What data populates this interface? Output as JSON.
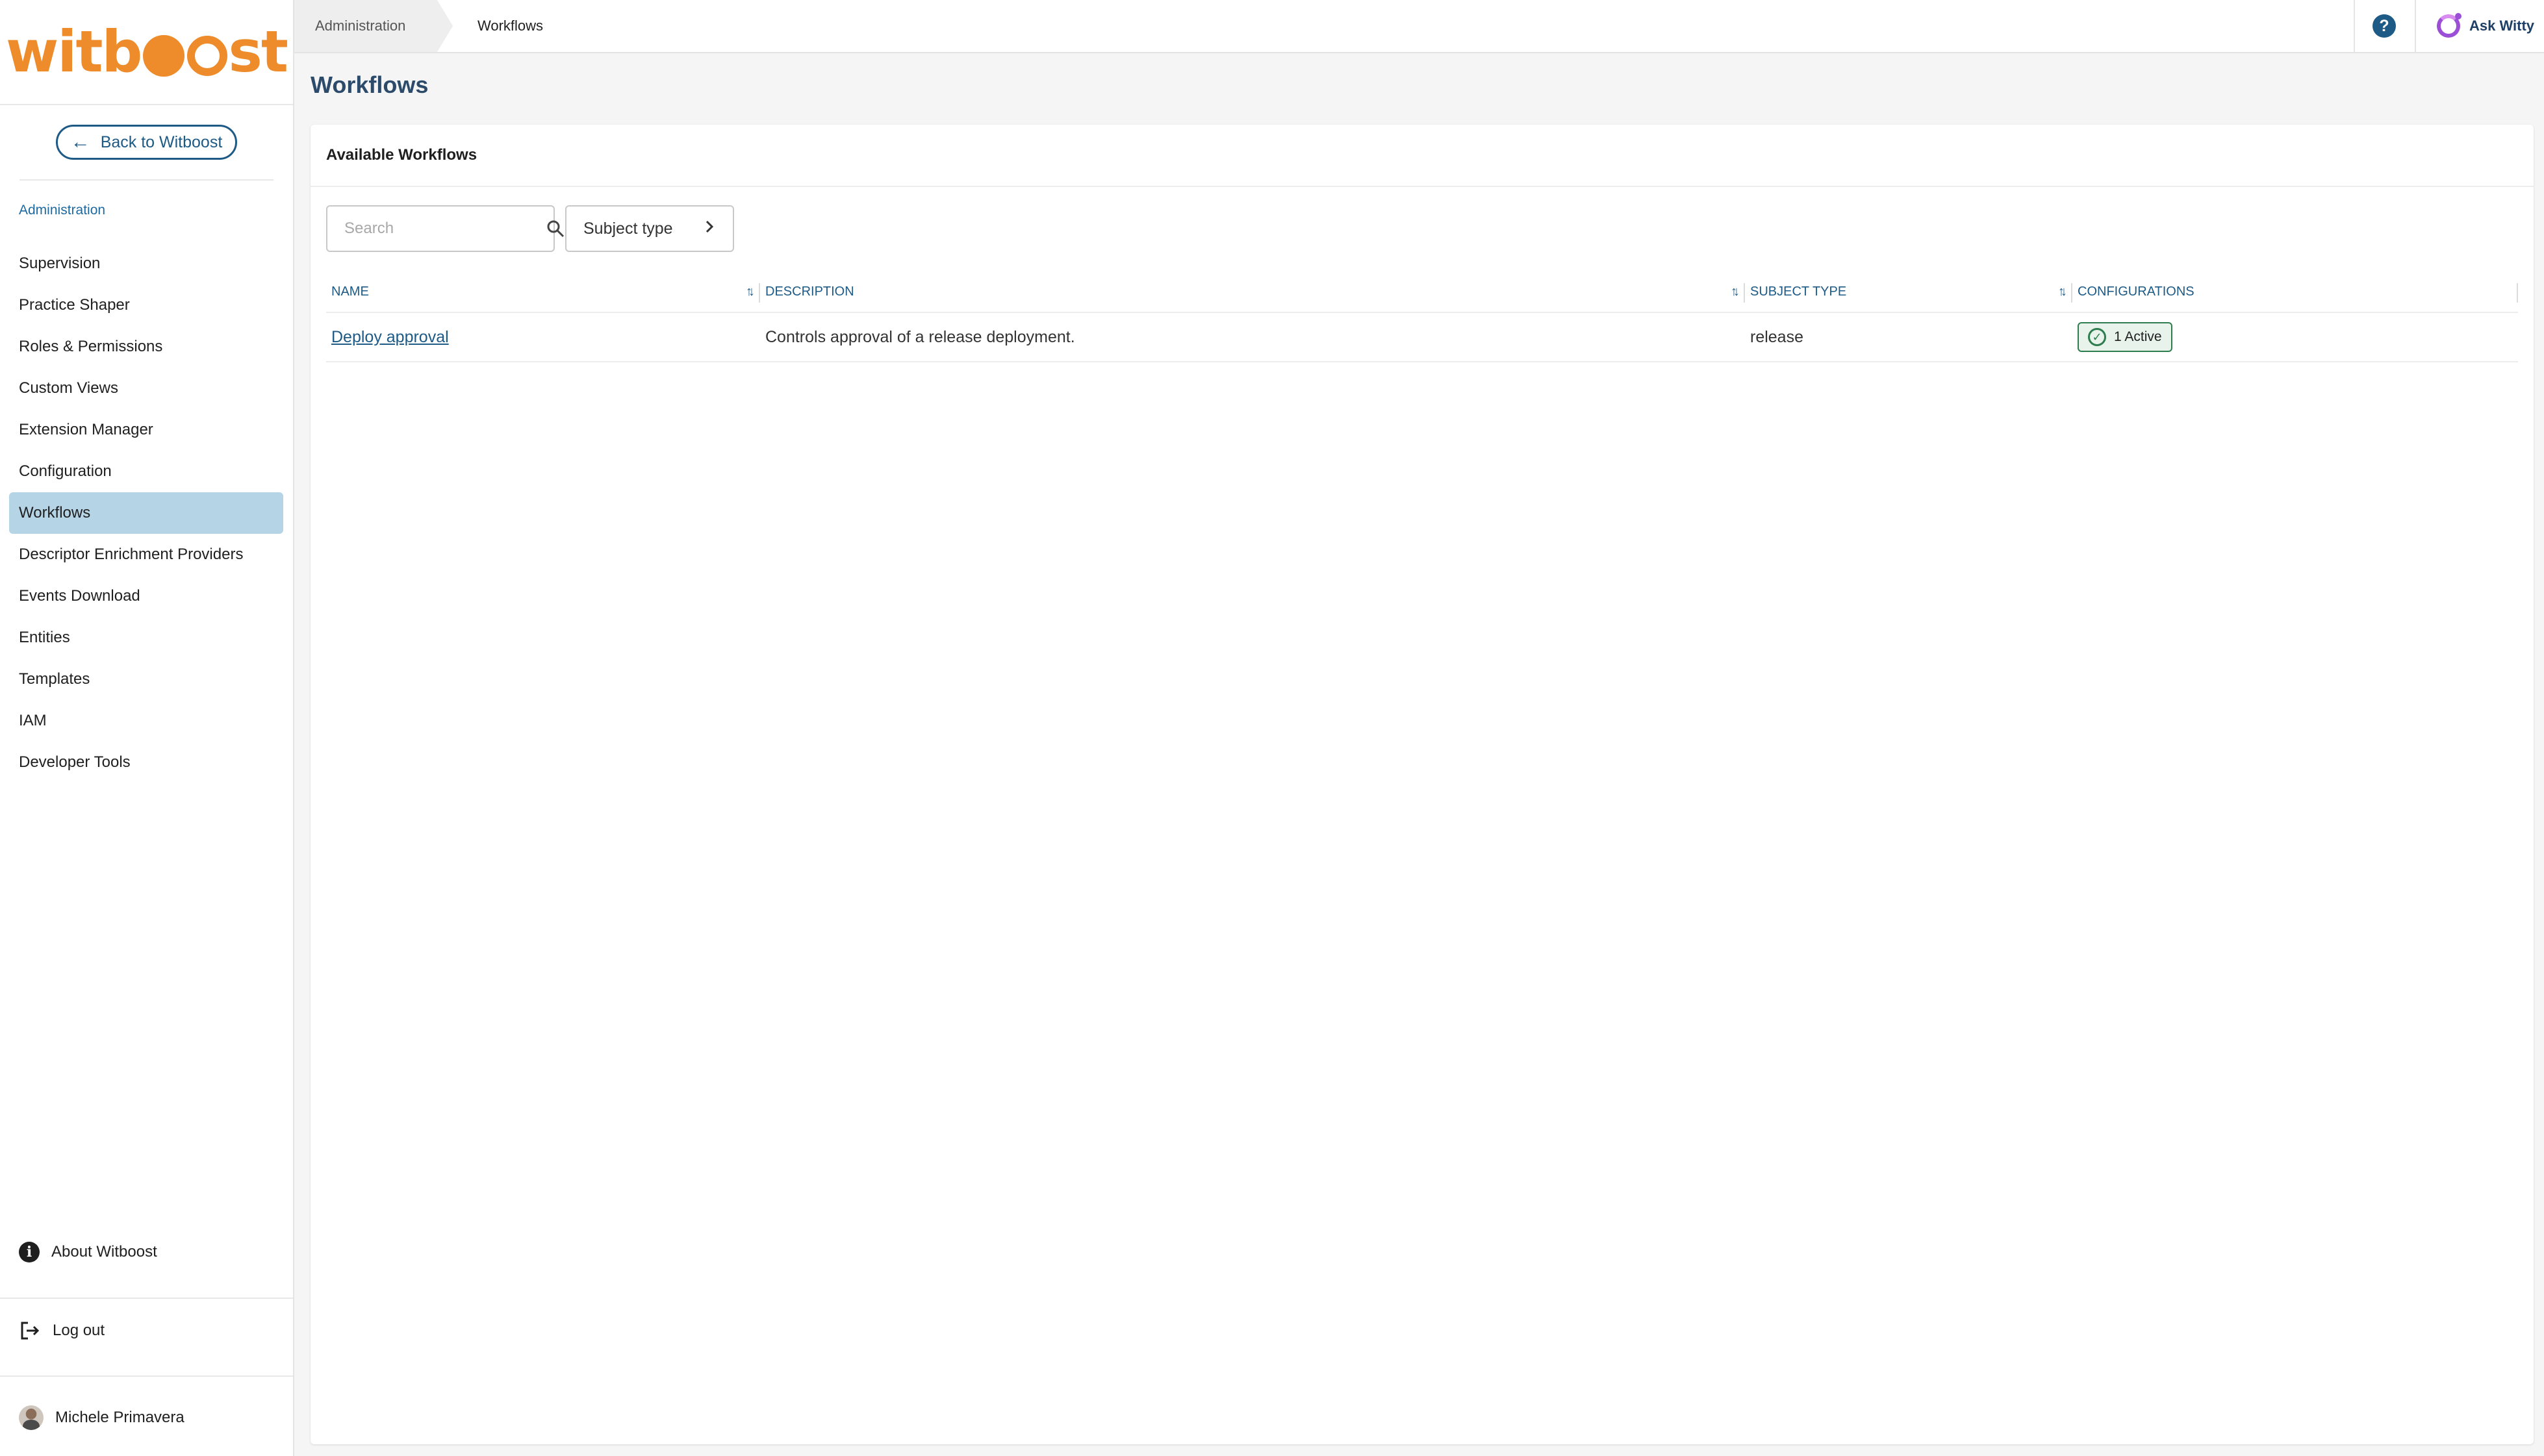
{
  "app": {
    "logo_text": "witboost",
    "back_label": "Back to Witboost"
  },
  "sidebar": {
    "section_label": "Administration",
    "items": [
      {
        "label": "Supervision",
        "active": false
      },
      {
        "label": "Practice Shaper",
        "active": false
      },
      {
        "label": "Roles & Permissions",
        "active": false
      },
      {
        "label": "Custom Views",
        "active": false
      },
      {
        "label": "Extension Manager",
        "active": false
      },
      {
        "label": "Configuration",
        "active": false
      },
      {
        "label": "Workflows",
        "active": true
      },
      {
        "label": "Descriptor Enrichment Providers",
        "active": false
      },
      {
        "label": "Events Download",
        "active": false
      },
      {
        "label": "Entities",
        "active": false
      },
      {
        "label": "Templates",
        "active": false
      },
      {
        "label": "IAM",
        "active": false
      },
      {
        "label": "Developer Tools",
        "active": false
      }
    ],
    "about_label": "About Witboost",
    "logout_label": "Log out",
    "user_name": "Michele Primavera"
  },
  "topbar": {
    "breadcrumb": [
      "Administration",
      "Workflows"
    ],
    "help_icon": "question-circle-icon",
    "assistant_label": "Ask Witty"
  },
  "main": {
    "title": "Workflows",
    "card_title": "Available Workflows",
    "search_placeholder": "Search",
    "filter_label": "Subject type",
    "columns": [
      "NAME",
      "DESCRIPTION",
      "SUBJECT TYPE",
      "CONFIGURATIONS"
    ],
    "rows": [
      {
        "name": "Deploy approval",
        "description": "Controls approval of a release deployment.",
        "subject_type": "release",
        "configurations": "1 Active"
      }
    ]
  },
  "colors": {
    "brand_orange": "#ee8b2b",
    "primary_blue": "#1e5a86",
    "active_nav_bg": "#b5d4e6",
    "badge_green": "#2e7d4f"
  }
}
